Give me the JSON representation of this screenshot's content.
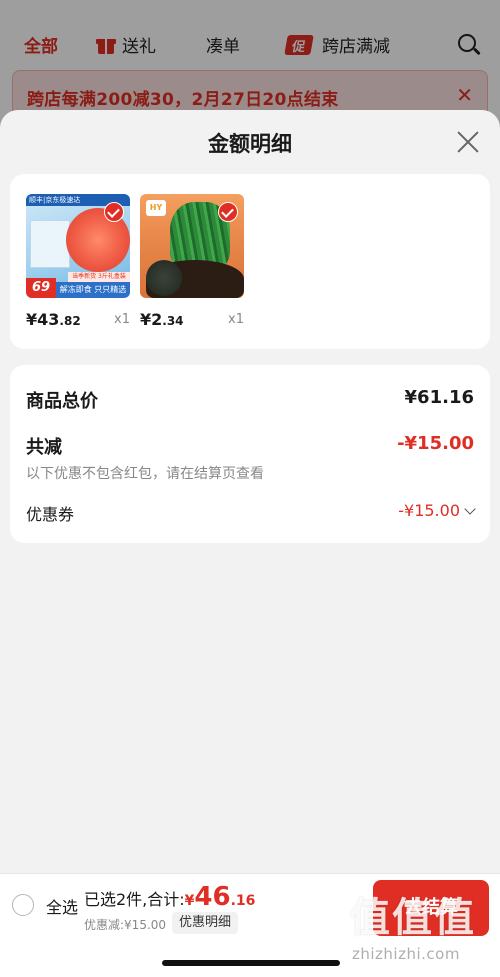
{
  "background": {
    "title": "",
    "tabs": [
      {
        "label": "全部"
      },
      {
        "label": "送礼"
      },
      {
        "label": "凑单"
      },
      {
        "label": "跨店满减",
        "icon_text": "促"
      }
    ],
    "promo_banner": "跨店每满200减30，2月27日20点结束"
  },
  "sheet": {
    "title": "金额明细",
    "products": [
      {
        "price_int": "¥43",
        "price_dec": ".82",
        "qty": "x1",
        "thumb": {
          "top_tag": "顺丰|京东极速达",
          "price_tag": "69",
          "mid_strip": "当季新货 3斤礼盒装",
          "bottom_strip": "解冻即食 只只精选"
        }
      },
      {
        "price_int": "¥2",
        "price_dec": ".34",
        "qty": "x1",
        "thumb": {
          "logo": "HY"
        }
      }
    ],
    "summary": {
      "goods_total_label": "商品总价",
      "goods_total_value": "¥61.16",
      "total_discount_label": "共减",
      "total_discount_value": "-¥15.00",
      "discount_note": "以下优惠不包含红包，请在结算页查看",
      "coupon_label": "优惠券",
      "coupon_value": "-¥15.00"
    }
  },
  "bottom_bar": {
    "select_all_label": "全选",
    "selected_text": "已选2件,合计:",
    "total_currency": "¥",
    "total_int": "46",
    "total_dec": ".16",
    "discount_text": "优惠减:¥15.00",
    "detail_toggle": "优惠明细",
    "checkout_label": "去结算",
    "watermark": "值值值",
    "watermark_url": "zhizhizhi.com"
  },
  "colors": {
    "accent": "#e02e24",
    "muted": "#888888",
    "page_bg": "#f2f2f2"
  }
}
